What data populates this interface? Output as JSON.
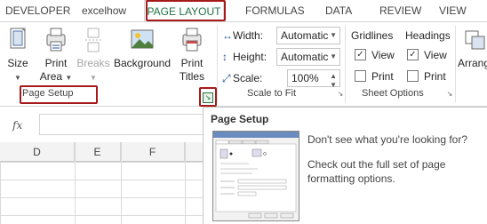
{
  "tabs": [
    "DEVELOPER",
    "excelhow",
    "PAGE LAYOUT",
    "FORMULAS",
    "DATA",
    "REVIEW",
    "VIEW"
  ],
  "page_setup_group": {
    "buttons": {
      "size": "Size",
      "print_area_line1": "Print",
      "print_area_line2": "Area",
      "breaks": "Breaks",
      "background": "Background",
      "print_titles_line1": "Print",
      "print_titles_line2": "Titles"
    },
    "label": "Page Setup"
  },
  "scale_to_fit": {
    "width_label": "Width:",
    "width_value": "Automatic",
    "height_label": "Height:",
    "height_value": "Automatic",
    "scale_label": "Scale:",
    "scale_value": "100%",
    "label": "Scale to Fit"
  },
  "sheet_options": {
    "gridlines": "Gridlines",
    "headings": "Headings",
    "view": "View",
    "print": "Print",
    "label": "Sheet Options"
  },
  "arrange": {
    "label": "Arrang"
  },
  "formula_bar": {
    "fx": "fx"
  },
  "columns": [
    "D",
    "E",
    "F"
  ],
  "tooltip": {
    "title": "Page Setup",
    "line1": "Don't see what you're looking for?",
    "line2": "Check out the full set of page formatting options."
  },
  "colors": {
    "accent": "#217346",
    "highlight": "#a51b1b"
  }
}
